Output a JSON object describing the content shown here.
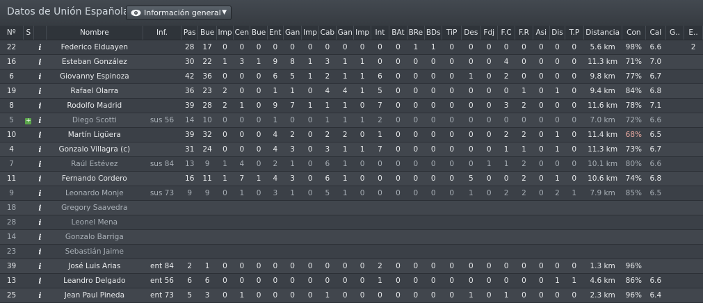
{
  "header": {
    "title": "Datos de Unión Española",
    "view_select": {
      "label": "Información general",
      "icon": "eye-icon"
    }
  },
  "table": {
    "columns": [
      "Nº",
      "S",
      "",
      "Nombre",
      "Inf.",
      "Pas",
      "Bue",
      "Imp",
      "Cen",
      "Bue",
      "Ent",
      "Gan",
      "Imp",
      "Cab",
      "Gan",
      "Imp",
      "Int",
      "BAt",
      "BRe",
      "BDs",
      "TiP",
      "Des",
      "Fdj",
      "F.C",
      "F.R",
      "Asi",
      "Dis",
      "T.P",
      "Distancia",
      "Con",
      "Cal",
      "G..",
      "E.."
    ],
    "rows": [
      [
        "22",
        "",
        "i",
        "Federico Elduayen",
        "",
        "28",
        "17",
        "0",
        "0",
        "0",
        "0",
        "0",
        "0",
        "0",
        "0",
        "0",
        "0",
        "0",
        "1",
        "1",
        "0",
        "0",
        "0",
        "0",
        "0",
        "0",
        "0",
        "0",
        "5.6 km",
        "98%",
        "6.6",
        "",
        "2"
      ],
      [
        "16",
        "",
        "i",
        "Esteban González",
        "",
        "30",
        "22",
        "1",
        "3",
        "1",
        "9",
        "8",
        "1",
        "3",
        "1",
        "1",
        "0",
        "0",
        "0",
        "0",
        "0",
        "0",
        "0",
        "4",
        "0",
        "0",
        "0",
        "0",
        "11.3 km",
        "71%",
        "7.0",
        "",
        ""
      ],
      [
        "6",
        "",
        "i",
        "Giovanny Espinoza",
        "",
        "42",
        "36",
        "0",
        "0",
        "0",
        "6",
        "5",
        "1",
        "2",
        "1",
        "1",
        "6",
        "0",
        "0",
        "0",
        "0",
        "1",
        "0",
        "2",
        "0",
        "0",
        "0",
        "0",
        "9.8 km",
        "77%",
        "6.7",
        "",
        ""
      ],
      [
        "19",
        "",
        "i",
        "Rafael Olarra",
        "",
        "36",
        "23",
        "2",
        "0",
        "0",
        "1",
        "1",
        "0",
        "4",
        "4",
        "1",
        "5",
        "0",
        "0",
        "0",
        "0",
        "0",
        "0",
        "0",
        "1",
        "0",
        "1",
        "0",
        "9.4 km",
        "84%",
        "6.8",
        "",
        ""
      ],
      [
        "8",
        "",
        "i",
        "Rodolfo Madrid",
        "",
        "39",
        "28",
        "2",
        "1",
        "0",
        "9",
        "7",
        "1",
        "1",
        "1",
        "0",
        "7",
        "0",
        "0",
        "0",
        "0",
        "0",
        "0",
        "3",
        "2",
        "0",
        "0",
        "0",
        "11.6 km",
        "78%",
        "7.1",
        "",
        ""
      ],
      [
        "5",
        "+",
        "i",
        "Diego Scotti",
        "sus 56",
        "14",
        "10",
        "0",
        "0",
        "0",
        "1",
        "0",
        "0",
        "1",
        "1",
        "1",
        "2",
        "0",
        "0",
        "0",
        "0",
        "0",
        "0",
        "0",
        "0",
        "0",
        "0",
        "0",
        "7.0 km",
        "72%",
        "6.6",
        "",
        ""
      ],
      [
        "10",
        "",
        "i",
        "Martín Ligüera",
        "",
        "39",
        "32",
        "0",
        "0",
        "0",
        "4",
        "2",
        "0",
        "2",
        "2",
        "0",
        "1",
        "0",
        "0",
        "0",
        "0",
        "0",
        "0",
        "2",
        "2",
        "0",
        "1",
        "0",
        "11.4 km",
        "68%",
        "6.5",
        "",
        ""
      ],
      [
        "4",
        "",
        "i",
        "Gonzalo Villagra (c)",
        "",
        "31",
        "24",
        "0",
        "0",
        "0",
        "4",
        "3",
        "0",
        "3",
        "1",
        "1",
        "7",
        "0",
        "0",
        "0",
        "0",
        "0",
        "0",
        "1",
        "1",
        "0",
        "1",
        "0",
        "11.3 km",
        "73%",
        "6.7",
        "",
        ""
      ],
      [
        "7",
        "",
        "i",
        "Raúl Estévez",
        "sus 84",
        "13",
        "9",
        "1",
        "4",
        "0",
        "2",
        "1",
        "0",
        "6",
        "1",
        "0",
        "0",
        "0",
        "0",
        "0",
        "0",
        "0",
        "1",
        "1",
        "2",
        "0",
        "0",
        "0",
        "10.1 km",
        "80%",
        "6.6",
        "",
        ""
      ],
      [
        "11",
        "",
        "i",
        "Fernando Cordero",
        "",
        "16",
        "11",
        "1",
        "7",
        "1",
        "4",
        "3",
        "0",
        "6",
        "1",
        "0",
        "0",
        "0",
        "0",
        "0",
        "0",
        "5",
        "0",
        "0",
        "2",
        "0",
        "1",
        "0",
        "10.6 km",
        "74%",
        "6.8",
        "",
        ""
      ],
      [
        "9",
        "",
        "i",
        "Leonardo Monje",
        "sus 73",
        "9",
        "9",
        "0",
        "1",
        "0",
        "3",
        "1",
        "0",
        "5",
        "1",
        "0",
        "0",
        "0",
        "0",
        "0",
        "0",
        "1",
        "0",
        "2",
        "2",
        "0",
        "2",
        "1",
        "7.9 km",
        "85%",
        "6.5",
        "",
        ""
      ],
      [
        "18",
        "",
        "i",
        "Gregory Saavedra",
        "",
        "",
        "",
        "",
        "",
        "",
        "",
        "",
        "",
        "",
        "",
        "",
        "",
        "",
        "",
        "",
        "",
        "",
        "",
        "",
        "",
        "",
        "",
        "",
        "",
        "",
        "",
        "",
        ""
      ],
      [
        "28",
        "",
        "i",
        "Leonel Mena",
        "",
        "",
        "",
        "",
        "",
        "",
        "",
        "",
        "",
        "",
        "",
        "",
        "",
        "",
        "",
        "",
        "",
        "",
        "",
        "",
        "",
        "",
        "",
        "",
        "",
        "",
        "",
        "",
        ""
      ],
      [
        "14",
        "",
        "i",
        "Gonzalo Barriga",
        "",
        "",
        "",
        "",
        "",
        "",
        "",
        "",
        "",
        "",
        "",
        "",
        "",
        "",
        "",
        "",
        "",
        "",
        "",
        "",
        "",
        "",
        "",
        "",
        "",
        "",
        "",
        "",
        ""
      ],
      [
        "23",
        "",
        "i",
        "Sebastián Jaime",
        "",
        "",
        "",
        "",
        "",
        "",
        "",
        "",
        "",
        "",
        "",
        "",
        "",
        "",
        "",
        "",
        "",
        "",
        "",
        "",
        "",
        "",
        "",
        "",
        "",
        "",
        "",
        "",
        ""
      ],
      [
        "39",
        "",
        "i",
        "José Luis Arias",
        "ent 84",
        "2",
        "1",
        "0",
        "0",
        "0",
        "0",
        "0",
        "0",
        "0",
        "0",
        "0",
        "2",
        "0",
        "0",
        "0",
        "0",
        "0",
        "0",
        "0",
        "0",
        "0",
        "0",
        "0",
        "1.3 km",
        "96%",
        "",
        "",
        ""
      ],
      [
        "13",
        "",
        "i",
        "Leandro Delgado",
        "ent 56",
        "6",
        "6",
        "0",
        "0",
        "0",
        "0",
        "0",
        "0",
        "0",
        "0",
        "0",
        "1",
        "0",
        "0",
        "0",
        "0",
        "0",
        "0",
        "0",
        "0",
        "0",
        "1",
        "1",
        "4.6 km",
        "86%",
        "6.6",
        "",
        ""
      ],
      [
        "25",
        "",
        "i",
        "Jean Paul Pineda",
        "ent 73",
        "5",
        "3",
        "0",
        "1",
        "0",
        "0",
        "0",
        "0",
        "1",
        "0",
        "0",
        "0",
        "0",
        "0",
        "0",
        "0",
        "1",
        "0",
        "1",
        "0",
        "0",
        "0",
        "0",
        "2.3 km",
        "96%",
        "6.4",
        "",
        ""
      ]
    ],
    "sub_rows": [
      5,
      8,
      10,
      11,
      12,
      13,
      14
    ],
    "red_cells": [
      [
        6,
        29
      ]
    ]
  }
}
